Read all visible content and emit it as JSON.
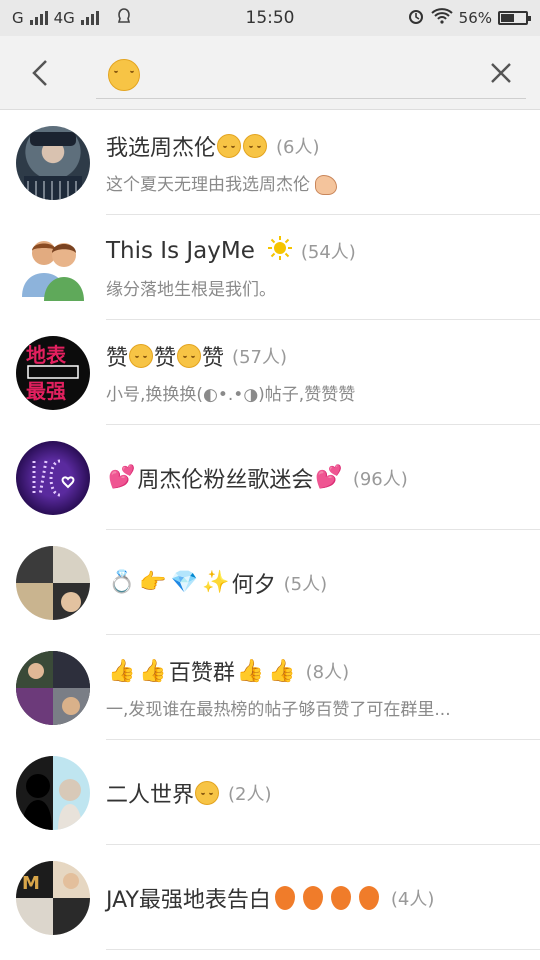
{
  "status_bar": {
    "carrier": "G",
    "network": "4G",
    "time": "15:50",
    "battery": "56%",
    "battery_level": 0.56
  },
  "search": {
    "back_icon": "chevron-left-icon",
    "query_icon": "smiley-emoji",
    "clear_icon": "close-icon"
  },
  "groups": [
    {
      "name": "我选周杰伦",
      "count": "(6人)",
      "desc": "这个夏天无理由我选周杰伦"
    },
    {
      "name": "This Is JayMe",
      "count": "(54人)",
      "desc": "缘分落地生根是我们。"
    },
    {
      "name_parts": [
        "赞",
        "赞",
        "赞"
      ],
      "count": "(57人)",
      "desc": "小号,换换换(◐•.•◑)帖子,赞赞赞"
    },
    {
      "name": "周杰伦粉丝歌迷会",
      "count": "(96人)",
      "desc": ""
    },
    {
      "name": "何夕",
      "count": "(5人)",
      "desc": ""
    },
    {
      "name": "百赞群",
      "count": "(8人)",
      "desc": "一,发现谁在最热榜的帖子够百赞了可在群里..."
    },
    {
      "name": "二人世界",
      "count": "(2人)",
      "desc": ""
    },
    {
      "name": "JAY最强地表告白",
      "count": "(4人)",
      "desc": ""
    }
  ],
  "colors": {
    "accent_emoji": "#f7c445",
    "balloon": "#f07c2a",
    "count_text": "#999999",
    "desc_text": "#8a8a8a"
  }
}
